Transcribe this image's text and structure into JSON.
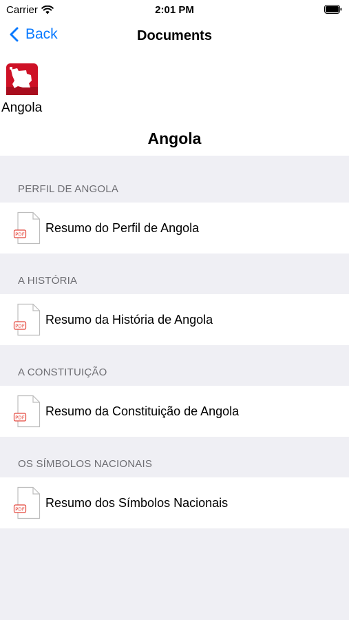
{
  "status": {
    "carrier": "Carrier",
    "time": "2:01 PM"
  },
  "nav": {
    "back_label": "Back",
    "title": "Documents"
  },
  "country": {
    "name": "Angola",
    "flag_colors": [
      "#ce1126",
      "#000000"
    ]
  },
  "heading": "Angola",
  "accent_color": "#0a7aff",
  "sections": [
    {
      "header": "PERFIL DE ANGOLA",
      "item": "Resumo do Perfil de Angola"
    },
    {
      "header": "A HISTÓRIA",
      "item": "Resumo da História de Angola"
    },
    {
      "header": "A CONSTITUIÇÃO",
      "item": "Resumo da Constituição de Angola"
    },
    {
      "header": "OS SÍMBOLOS NACIONAIS",
      "item": "Resumo dos Símbolos Nacionais"
    }
  ],
  "icons": {
    "document": "pdf-file-icon",
    "back": "chevron-left-icon"
  }
}
